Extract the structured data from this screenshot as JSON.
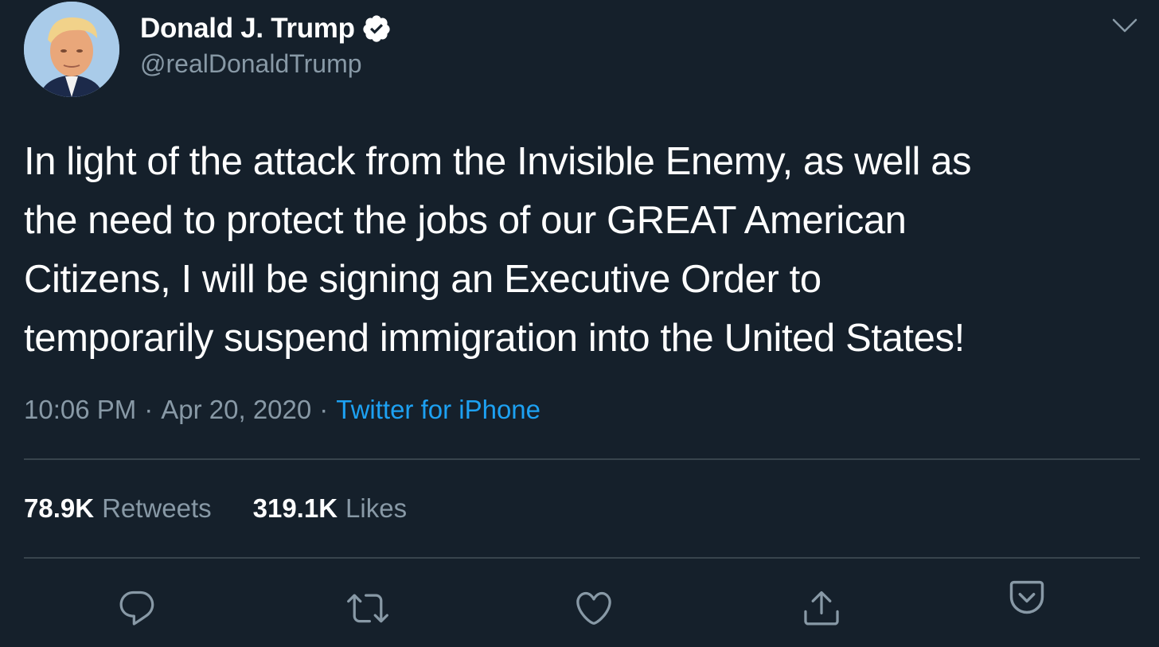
{
  "author": {
    "display_name": "Donald J. Trump",
    "handle": "@realDonaldTrump",
    "verified": true
  },
  "tweet": {
    "text": "In light of the attack from the Invisible Enemy, as well as\nthe need to protect the jobs of our GREAT American\nCitizens, I will be signing an Executive Order to\ntemporarily suspend immigration into the United States!",
    "time": "10:06 PM",
    "separator": "·",
    "date": "Apr 20, 2020",
    "source": "Twitter for iPhone"
  },
  "stats": {
    "retweets_count": "78.9K",
    "retweets_label": "Retweets",
    "likes_count": "319.1K",
    "likes_label": "Likes"
  },
  "actions": [
    {
      "icon": "reply-icon"
    },
    {
      "icon": "retweet-icon"
    },
    {
      "icon": "like-icon"
    },
    {
      "icon": "share-icon"
    },
    {
      "icon": "save-icon"
    }
  ],
  "colors": {
    "background": "#15202b",
    "text_primary": "#ffffff",
    "text_secondary": "#8899a6",
    "accent": "#1da1f2",
    "divider": "#38444d"
  }
}
